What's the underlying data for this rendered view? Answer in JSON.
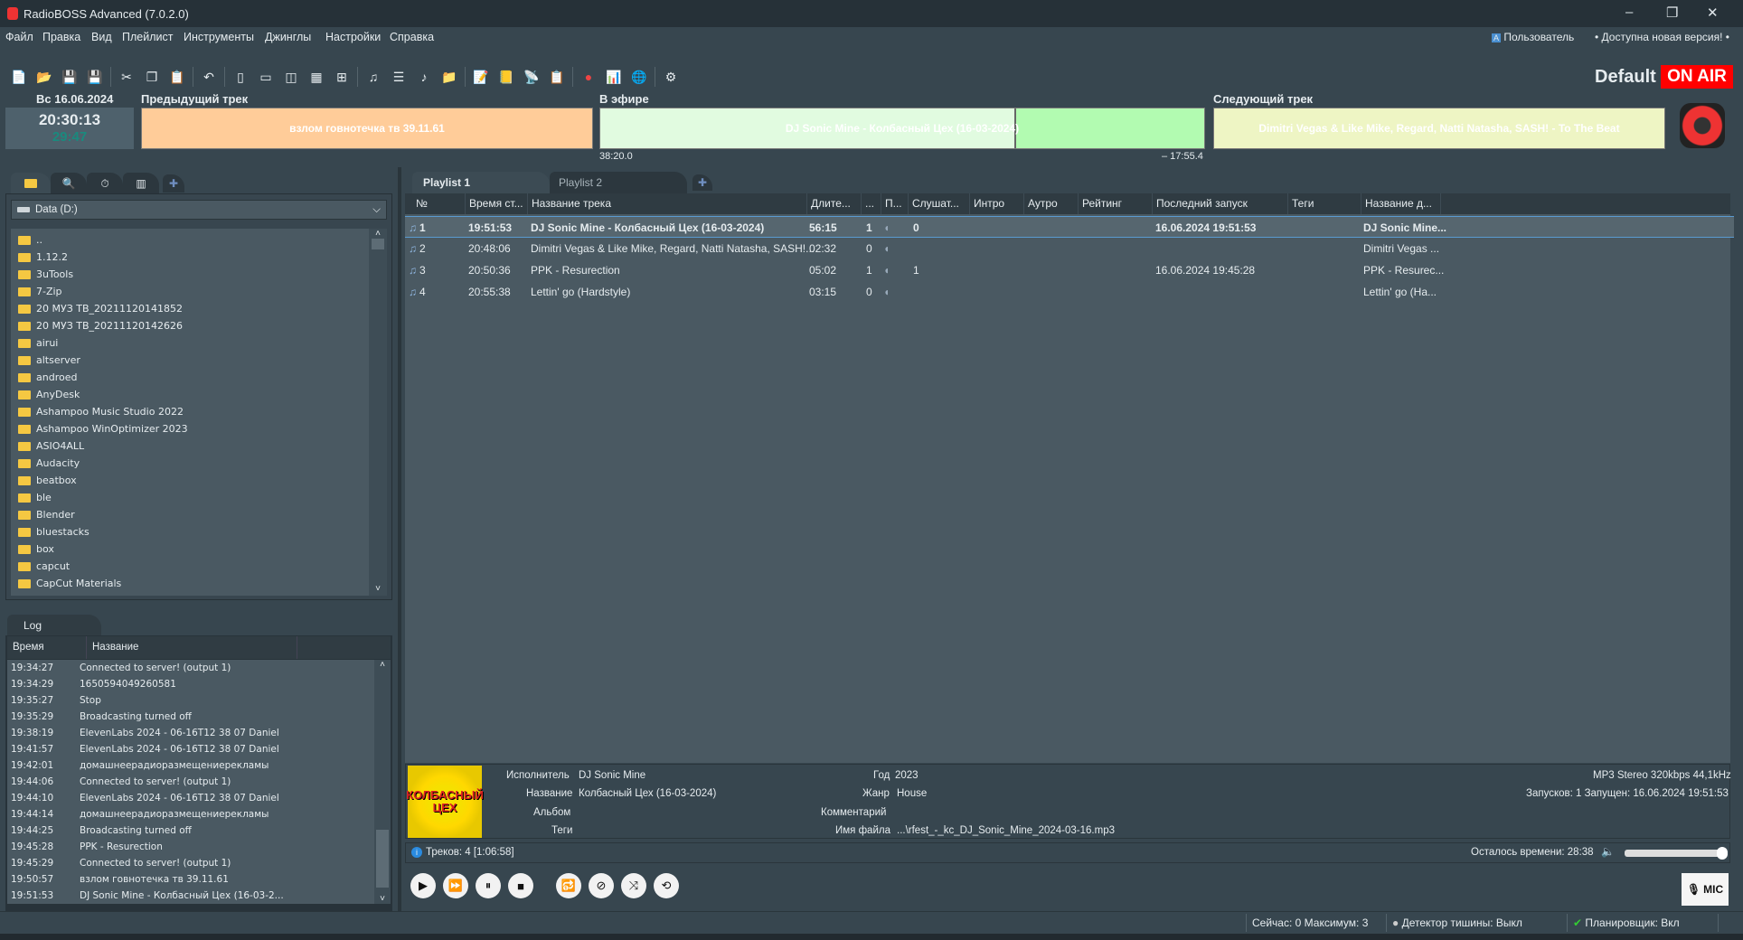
{
  "window": {
    "title": "RadioBOSS Advanced (7.0.2.0)",
    "minimize": "–",
    "maximize": "❐",
    "close": "✕"
  },
  "menu": [
    "Файл",
    "Правка",
    "Вид",
    "Плейлист",
    "Инструменты",
    "Джинглы",
    "Настройки",
    "Справка"
  ],
  "user": {
    "label": "Пользователь",
    "update": "• Доступна новая версия! •"
  },
  "toolbar_icons": [
    "new-file-icon",
    "open-folder-icon",
    "save-icon",
    "save-as-icon",
    "|",
    "cut-icon",
    "copy-icon",
    "paste-icon",
    "|",
    "undo-icon",
    "|",
    "layout-1-icon",
    "layout-2-icon",
    "layout-3-icon",
    "layout-4-icon",
    "layout-add-icon",
    "|",
    "add-track-icon",
    "add-list-icon",
    "add-music-icon",
    "add-folder-icon",
    "|",
    "report-icon",
    "jingle-folder-icon",
    "satellite-icon",
    "clipboard-icon",
    "|",
    "record-icon",
    "stats-icon",
    "globe-icon",
    "|",
    "settings-icon"
  ],
  "profile": {
    "name": "Default",
    "on_air": "ON AIR"
  },
  "clock": {
    "date": "Вс 16.06.2024",
    "time": "20:30:13",
    "remaining": "29:47"
  },
  "prev": {
    "label": "Предыдущий трек",
    "title": "взлом говнотечка тв 39.11.61",
    "color": "#ffcc99"
  },
  "onair": {
    "label": "В эфире",
    "title": "DJ Sonic Mine - Колбасный Цех (16-03-2024)",
    "elapsed": "38:20.0",
    "left": "– 17:55.4",
    "progress": 0.685
  },
  "next": {
    "label": "Следующий трек",
    "title": "Dimitri Vegas & Like Mike, Regard, Natti Natasha, SASH! - To The Beat",
    "color": "#eef5c4"
  },
  "browser": {
    "drive": "Data (D:)",
    "folders": [
      "..",
      "1.12.2",
      "3uTools",
      "7-Zip",
      "20 МУЗ ТВ_20211120141852",
      "20 МУЗ ТВ_20211120142626",
      "airui",
      "altserver",
      "androed",
      "AnyDesk",
      "Ashampoo Music Studio 2022",
      "Ashampoo WinOptimizer 2023",
      "ASIO4ALL",
      "Audacity",
      "beatbox",
      "ble",
      "Blender",
      "bluestacks",
      "box",
      "capcut",
      "CapCut Materials"
    ]
  },
  "log": {
    "tab": "Log",
    "col_time": "Время",
    "col_name": "Название",
    "rows": [
      [
        "19:34:27",
        "Connected to server! (output 1)"
      ],
      [
        "19:34:29",
        "1650594049260581"
      ],
      [
        "19:35:27",
        "Stop"
      ],
      [
        "19:35:29",
        "Broadcasting turned off"
      ],
      [
        "19:38:19",
        "ElevenLabs 2024 - 06-16T12 38 07 Daniel"
      ],
      [
        "19:41:57",
        "ElevenLabs 2024 - 06-16T12 38 07 Daniel"
      ],
      [
        "19:42:01",
        "домашнеерадиоразмещениерекламы"
      ],
      [
        "19:44:06",
        "Connected to server! (output 1)"
      ],
      [
        "19:44:10",
        "ElevenLabs 2024 - 06-16T12 38 07 Daniel"
      ],
      [
        "19:44:14",
        "домашнеерадиоразмещениерекламы"
      ],
      [
        "19:44:25",
        "Broadcasting turned off"
      ],
      [
        "19:45:28",
        "PPK - Resurection"
      ],
      [
        "19:45:29",
        "Connected to server! (output 1)"
      ],
      [
        "19:50:57",
        "взлом говнотечка тв 39.11.61"
      ],
      [
        "19:51:53",
        "DJ Sonic Mine - Колбасный Цех (16-03-2..."
      ]
    ]
  },
  "playlist": {
    "tabs": [
      "Playlist 1",
      "Playlist 2"
    ],
    "columns": [
      "№",
      "Время ст...",
      "Название трека",
      "Длите...",
      "...",
      "П...",
      "Слушат...",
      "Интро",
      "Аутро",
      "Рейтинг",
      "Последний запуск",
      "Теги",
      "Название д..."
    ],
    "rows": [
      {
        "n": "1",
        "start": "19:51:53",
        "title": "DJ Sonic Mine - Колбасный Цех (16-03-2024)",
        "dur": "56:15",
        "c": "1",
        "listen": "0",
        "last": "16.06.2024 19:51:53",
        "name": "DJ Sonic Mine..."
      },
      {
        "n": "2",
        "start": "20:48:06",
        "title": "Dimitri Vegas & Like Mike, Regard, Natti Natasha, SASH!...",
        "dur": "02:32",
        "c": "0",
        "listen": "",
        "last": "",
        "name": "Dimitri Vegas ..."
      },
      {
        "n": "3",
        "start": "20:50:36",
        "title": "PPK - Resurection",
        "dur": "05:02",
        "c": "1",
        "listen": "1",
        "last": "16.06.2024 19:45:28",
        "name": "PPK - Resurec..."
      },
      {
        "n": "4",
        "start": "20:55:38",
        "title": "Lettin' go (Hardstyle)",
        "dur": "03:15",
        "c": "0",
        "listen": "",
        "last": "",
        "name": "Lettin' go (Ha..."
      }
    ]
  },
  "info": {
    "artist_l": "Исполнитель",
    "artist": "DJ Sonic Mine",
    "title_l": "Название",
    "title": "Колбасный Цех (16-03-2024)",
    "album_l": "Альбом",
    "tags_l": "Теги",
    "year_l": "Год",
    "year": "2023",
    "genre_l": "Жанр",
    "genre": "House",
    "comment_l": "Комментарий",
    "file_l": "Имя файла",
    "file": "...\\rfest_-_kc_DJ_Sonic_Mine_2024-03-16.mp3",
    "format": "MP3 Stereo 320kbps 44,1kHz",
    "plays": "Запусков: 1  Запущен: 16.06.2024 19:51:53",
    "art_text": "КОЛБАСНЫЙ ЦЕХ"
  },
  "status": {
    "tracks": "Треков: 4 [1:06:58]",
    "remaining": "Осталось времени: 28:38",
    "volume": 1.0
  },
  "mic": "MIC",
  "statusbar": {
    "listeners": "Сейчас: 0  Максимум: 3",
    "silence": "Детектор тишины: Выкл",
    "scheduler": "Планировщик: Вкл"
  }
}
